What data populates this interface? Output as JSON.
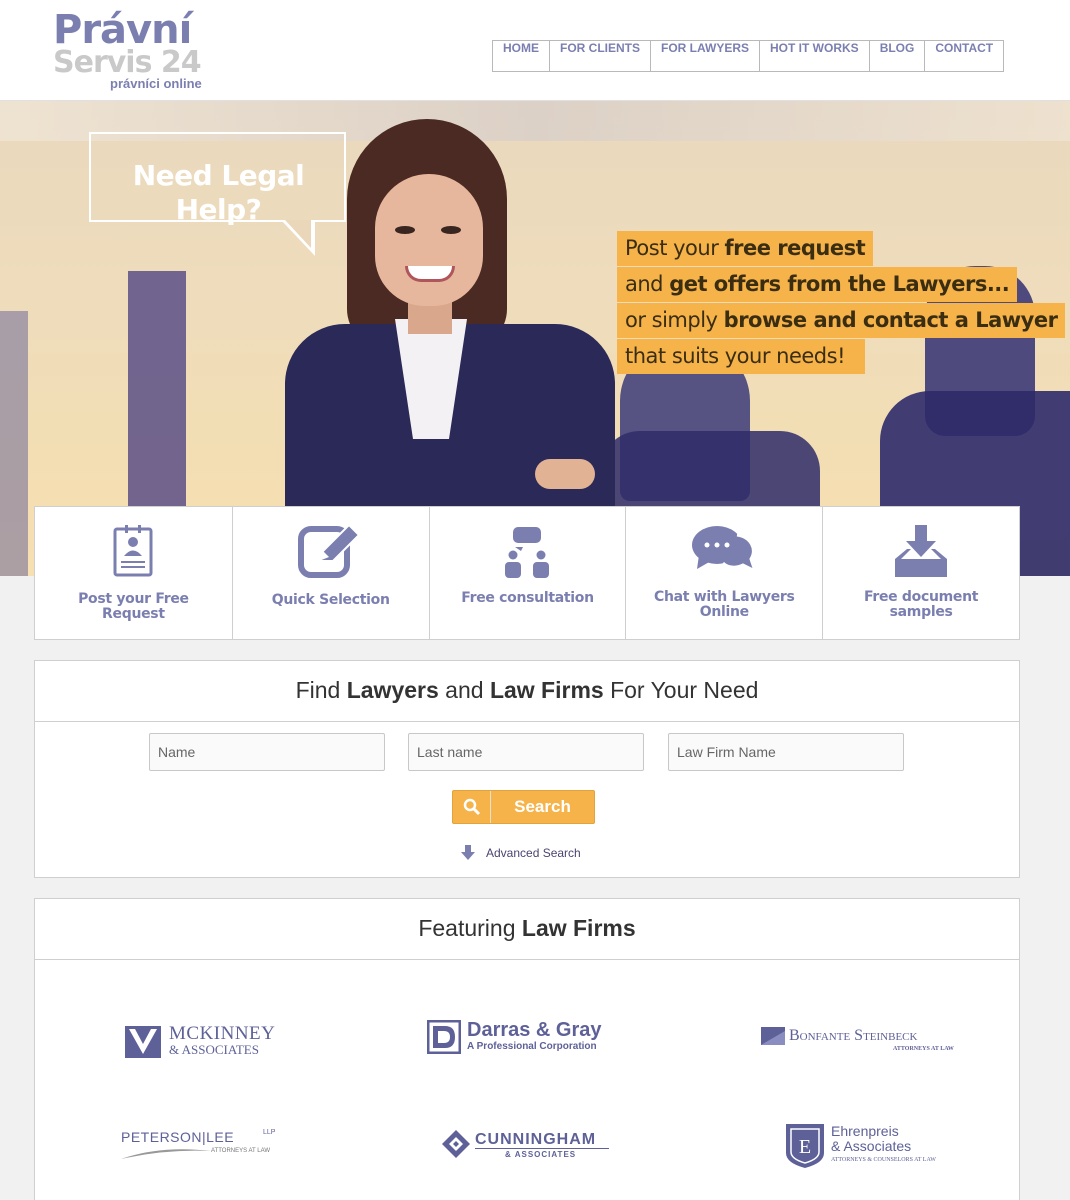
{
  "logo": {
    "line1": "Právní",
    "line2": "Servis 24",
    "tagline": "právníci online"
  },
  "nav": [
    "HOME",
    "FOR CLIENTS",
    "FOR LAWYERS",
    "HOT IT WORKS",
    "BLOG",
    "CONTACT"
  ],
  "hero": {
    "bubble": "Need Legal Help?",
    "lines": [
      {
        "pre": "Post your ",
        "bold": "free request",
        "post": ""
      },
      {
        "pre": "and ",
        "bold": "get offers from the Lawyers...",
        "post": ""
      },
      {
        "pre": "or simply ",
        "bold": "browse and contact a Lawyer",
        "post": ""
      },
      {
        "pre": "that suits your needs!",
        "bold": "",
        "post": ""
      }
    ]
  },
  "tiles": [
    {
      "label": "Post your Free Request",
      "icon": "clipboard-user-icon"
    },
    {
      "label": "Quick Selection",
      "icon": "edit-pencil-icon"
    },
    {
      "label": "Free consultation",
      "icon": "consultation-people-icon"
    },
    {
      "label": "Chat with Lawyers Online",
      "icon": "chat-bubbles-icon"
    },
    {
      "label": "Free document samples",
      "icon": "download-tray-icon"
    }
  ],
  "search": {
    "title_1": "Find ",
    "title_2": "Lawyers",
    "title_3": " and ",
    "title_4": "Law Firms",
    "title_5": " For Your Need",
    "name_placeholder": "Name",
    "lastname_placeholder": "Last name",
    "firm_placeholder": "Law Firm Name",
    "button": "Search",
    "advanced": "Advanced Search"
  },
  "featuring": {
    "title_1": "Featuring ",
    "title_2": "Law Firms",
    "firms": [
      {
        "name": "McKinney",
        "sub": "& Associates"
      },
      {
        "name": "Darras & Gray",
        "sub": "A Professional Corporation"
      },
      {
        "name": "Bonfante Steinbeck",
        "sub": "Attorneys at Law"
      },
      {
        "name": "Peterson|Lee",
        "sup": "LLP",
        "sub": "Attorneys at Law"
      },
      {
        "name": "Cunningham",
        "sub": "& Associates"
      },
      {
        "name": "Ehrenpreis",
        "name2": "& Associates",
        "sub": "Attorneys & Counselors at Law"
      }
    ]
  },
  "colors": {
    "brand": "#7b7fb0",
    "accent": "#f6b34a",
    "hero_dark": "#2b2957"
  }
}
